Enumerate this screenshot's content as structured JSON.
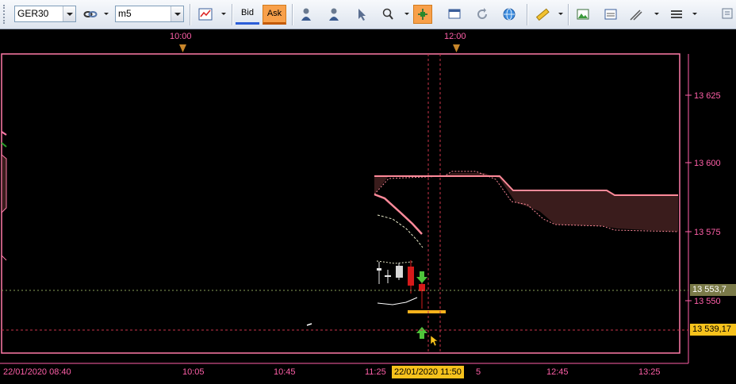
{
  "toolbar": {
    "symbol": "GER30",
    "timeframe": "m5",
    "bid_label": "Bid",
    "ask_label": "Ask"
  },
  "time_axis_top": [
    "10:00",
    "12:00"
  ],
  "price_axis": {
    "ticks": [
      "13 625",
      "13 600",
      "13 575",
      "13 550"
    ],
    "bid_tag": "13 553,7",
    "cursor_tag": "13 539,17"
  },
  "time_axis_bottom": {
    "labels": [
      "22/01/2020 08:40",
      "10:05",
      "10:45",
      "11:25",
      "5",
      "12:45",
      "13:25"
    ],
    "cursor_time": "22/01/2020 11:50"
  },
  "colors": {
    "axis": "#ff5fa8",
    "frame": "#ff7aa8",
    "bearish": "#d51a1a",
    "bullish": "#e8e8e8",
    "cloud": "#3a1c1c",
    "cursor": "#f7c21c",
    "buy_arrow": "#4fc43a",
    "sell_arrow": "#4fc43a"
  }
}
